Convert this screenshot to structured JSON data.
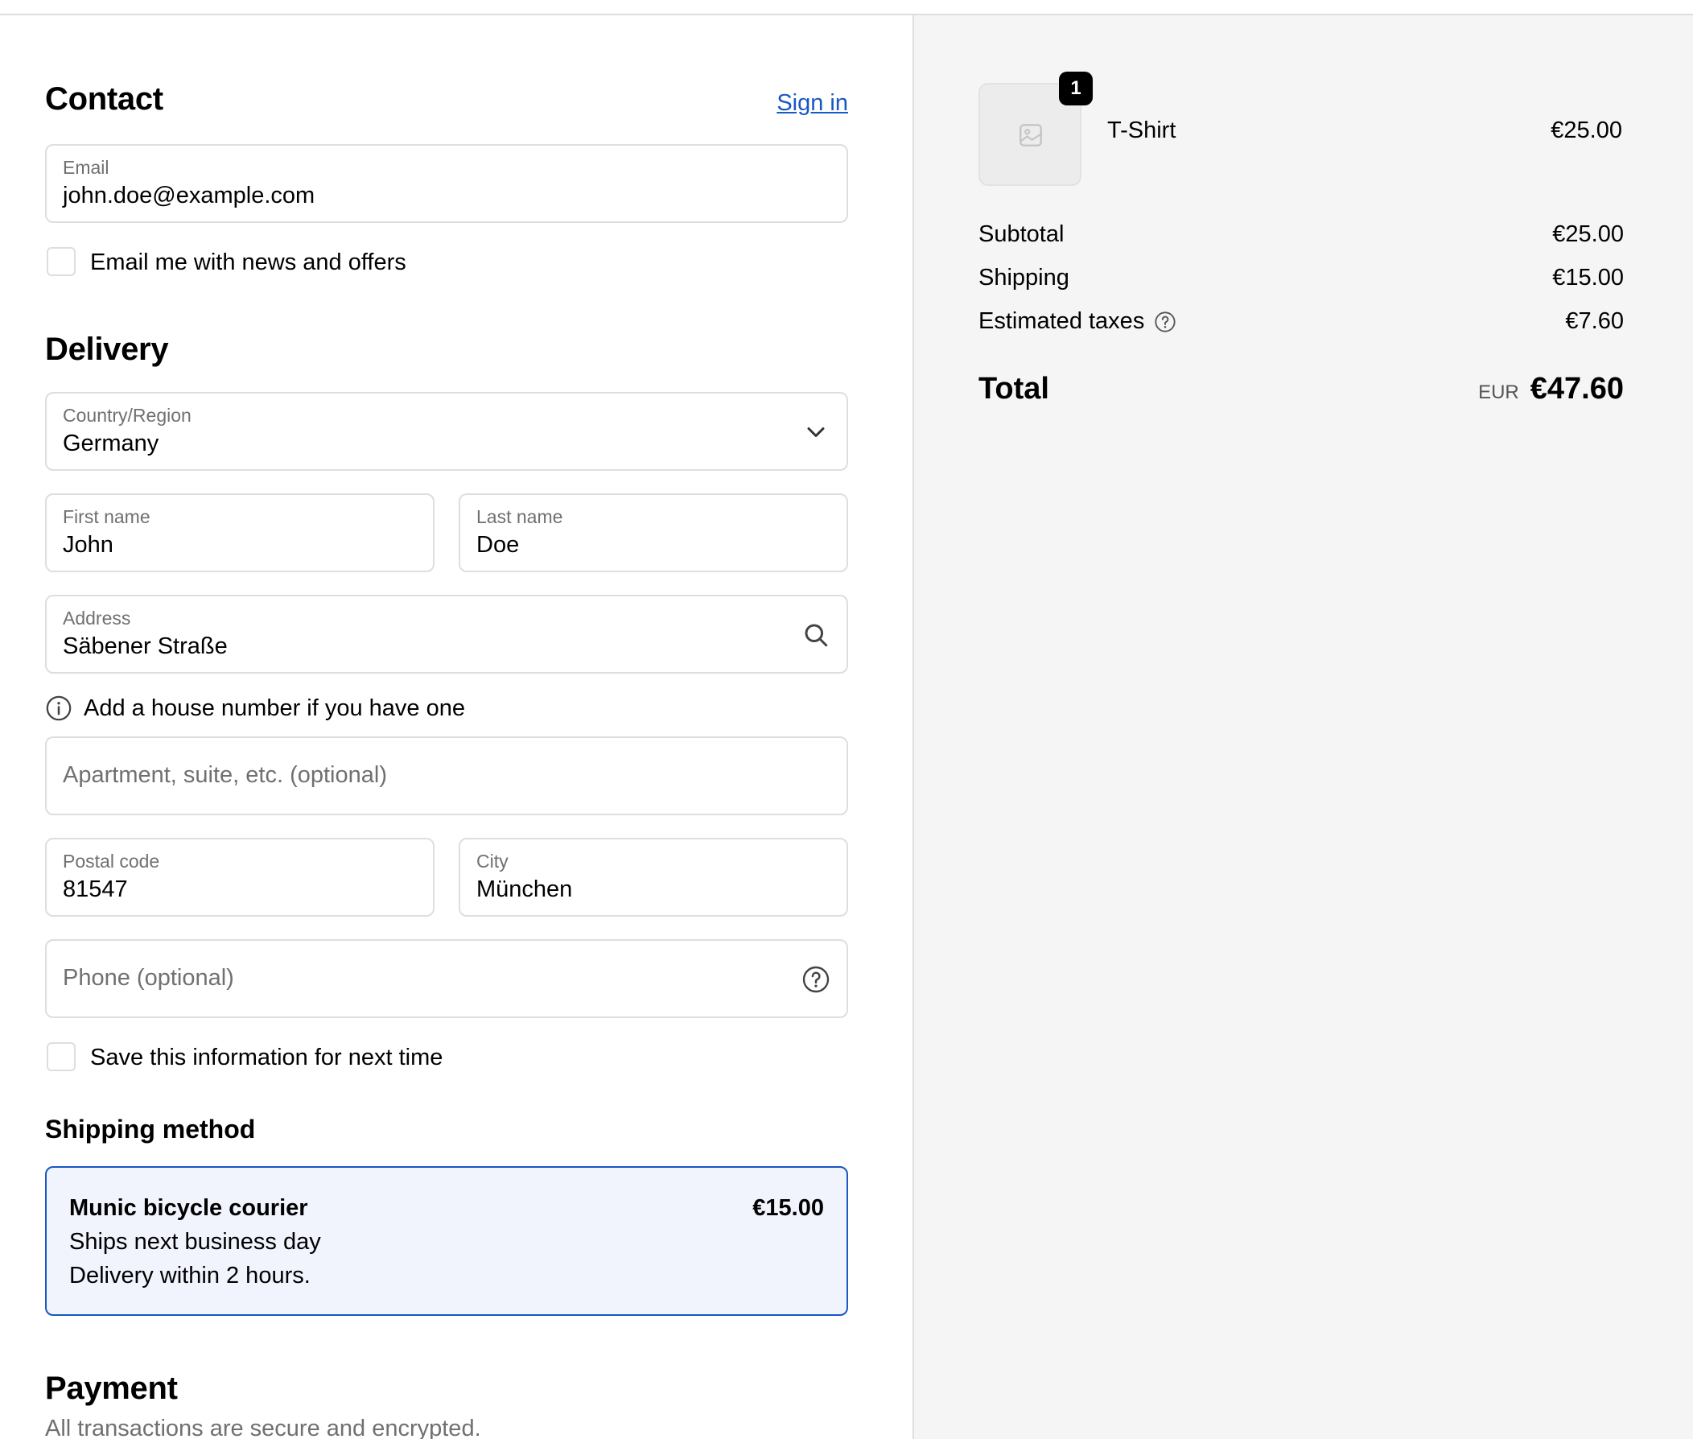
{
  "contact": {
    "title": "Contact",
    "sign_in": "Sign in",
    "email_label": "Email",
    "email_value": "john.doe@example.com",
    "newsletter_label": "Email me with news and offers",
    "newsletter_checked": false
  },
  "delivery": {
    "title": "Delivery",
    "country_label": "Country/Region",
    "country_value": "Germany",
    "first_name_label": "First name",
    "first_name_value": "John",
    "last_name_label": "Last name",
    "last_name_value": "Doe",
    "address_label": "Address",
    "address_value": "Säbener Straße",
    "address_hint": "Add a house number if you have one",
    "apartment_placeholder": "Apartment, suite, etc. (optional)",
    "postal_label": "Postal code",
    "postal_value": "81547",
    "city_label": "City",
    "city_value": "München",
    "phone_placeholder": "Phone (optional)",
    "save_info_label": "Save this information for next time",
    "save_info_checked": false
  },
  "shipping_method": {
    "title": "Shipping method",
    "option": {
      "name": "Munic bicycle courier",
      "price": "€15.00",
      "line1": "Ships next business day",
      "line2": "Delivery within 2 hours.",
      "selected": true
    }
  },
  "payment": {
    "title": "Payment",
    "subtitle": "All transactions are secure and encrypted."
  },
  "summary": {
    "item": {
      "name": "T-Shirt",
      "price": "€25.00",
      "quantity": "1"
    },
    "subtotal_label": "Subtotal",
    "subtotal_value": "€25.00",
    "shipping_label": "Shipping",
    "shipping_value": "€15.00",
    "taxes_label": "Estimated taxes",
    "taxes_value": "€7.60",
    "total_label": "Total",
    "total_currency": "EUR",
    "total_value": "€47.60"
  },
  "colors": {
    "accent": "#1957c2",
    "selected_bg": "#f1f4fd",
    "sidebar_bg": "#f5f5f5",
    "border": "#dedede",
    "muted_text": "#707070"
  },
  "icons": {
    "country_select": "chevron-down-icon",
    "address_search": "search-icon",
    "address_hint": "info-icon",
    "phone_help": "question-circle-icon",
    "taxes_help": "question-circle-icon",
    "product_placeholder": "image-placeholder-icon"
  }
}
